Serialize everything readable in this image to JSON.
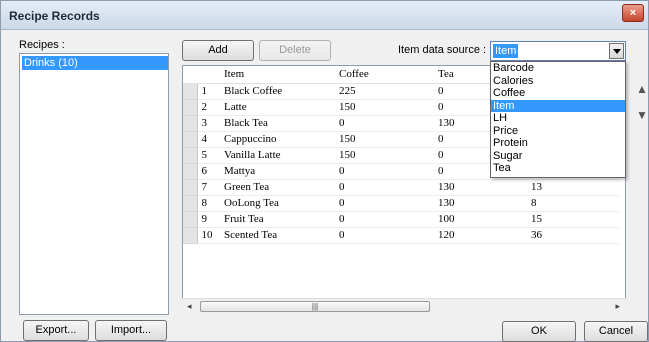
{
  "window": {
    "title": "Recipe Records",
    "close_label": "×"
  },
  "recipes": {
    "label": "Recipes :",
    "items": [
      "Drinks (10)"
    ]
  },
  "toolbar": {
    "add_label": "Add",
    "delete_label": "Delete"
  },
  "source": {
    "label": "Item data source :",
    "value": "Item",
    "options": [
      "Barcode",
      "Calories",
      "Coffee",
      "Item",
      "LH",
      "Price",
      "Protein",
      "Sugar",
      "Tea"
    ]
  },
  "table": {
    "columns": [
      "Item",
      "Coffee",
      "Tea"
    ],
    "rows": [
      {
        "n": "1",
        "item": "Black Coffee",
        "coffee": "225",
        "tea": "0",
        "last": ""
      },
      {
        "n": "2",
        "item": "Latte",
        "coffee": "150",
        "tea": "0",
        "last": ""
      },
      {
        "n": "3",
        "item": "Black Tea",
        "coffee": "0",
        "tea": "130",
        "last": ""
      },
      {
        "n": "4",
        "item": "Cappuccino",
        "coffee": "150",
        "tea": "0",
        "last": ""
      },
      {
        "n": "5",
        "item": "Vanilla Latte",
        "coffee": "150",
        "tea": "0",
        "last": ""
      },
      {
        "n": "6",
        "item": "Mattya",
        "coffee": "0",
        "tea": "0",
        "last": ""
      },
      {
        "n": "7",
        "item": "Green Tea",
        "coffee": "0",
        "tea": "130",
        "last": "13"
      },
      {
        "n": "8",
        "item": "OoLong Tea",
        "coffee": "0",
        "tea": "130",
        "last": "8"
      },
      {
        "n": "9",
        "item": "Fruit Tea",
        "coffee": "0",
        "tea": "100",
        "last": "15"
      },
      {
        "n": "10",
        "item": "Scented Tea",
        "coffee": "0",
        "tea": "120",
        "last": "36"
      }
    ]
  },
  "scroll": {
    "left_arrow": "◂",
    "right_arrow": "▸",
    "thumb_grip": "|||"
  },
  "side_arrows": {
    "up": "▲",
    "down": "▼"
  },
  "footer": {
    "export_label": "Export...",
    "import_label": "Import...",
    "ok_label": "OK",
    "cancel_label": "Cancel"
  }
}
